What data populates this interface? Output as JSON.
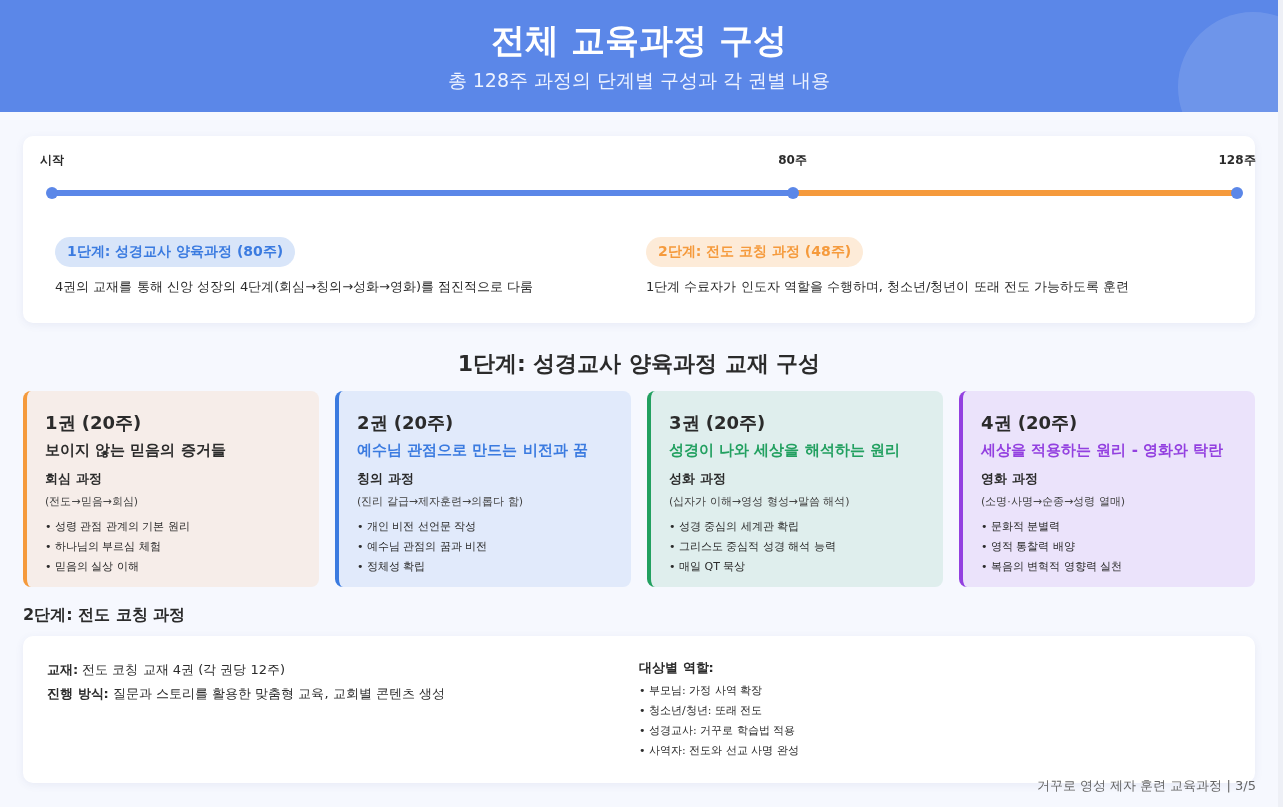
{
  "header": {
    "title": "전체 교육과정 구성",
    "subtitle": "총 128주 과정의 단계별 구성과 각 권별 내용"
  },
  "timeline": {
    "markers": [
      {
        "label": "시작",
        "level": 0
      },
      {
        "label": "80주",
        "level": 0.625
      },
      {
        "label": "128주",
        "level": 1
      }
    ],
    "progress": {
      "level": 0.625
    },
    "phases": [
      {
        "badge": "1단계: 성경교사 양육과정 (80주)",
        "color": "#3b7be0",
        "description": "4권의 교재를 통해 신앙 성장의 4단계(회심→칭의→성화→영화)를 점진적으로 다룸"
      },
      {
        "badge": "2단계: 전도 코칭 과정 (48주)",
        "color": "#f59a3c",
        "description": "1단계 수료자가 인도자 역할을 수행하며, 청소년/청년이 또래 전도 가능하도록 훈련"
      }
    ]
  },
  "books_section": {
    "title": "1단계: 성경교사 양육과정 교재 구성",
    "books": [
      {
        "volume": "1권 (20주)",
        "title": "보이지 않는 믿음의 증거들",
        "color": "#f59a3c",
        "stage": "회심 과정",
        "flow": "(전도→믿음→회심)",
        "points": [
          "• 성령 관점 관계의 기본 원리",
          "• 하나님의 부르심 체험",
          "• 믿음의 실상 이해"
        ]
      },
      {
        "volume": "2권 (20주)",
        "title": "예수님 관점으로 만드는 비전과 꿈",
        "color": "#3b7be0",
        "stage": "칭의 과정",
        "flow": "(진리 갈급→제자훈련→의롭다 함)",
        "points": [
          "• 개인 비전 선언문 작성",
          "• 예수님 관점의 꿈과 비전",
          "• 정체성 확립"
        ]
      },
      {
        "volume": "3권 (20주)",
        "title": "성경이 나와 세상을 해석하는 원리",
        "color": "#22a060",
        "stage": "성화 과정",
        "flow": "(십자가 이해→영성 형성→말씀 해석)",
        "points": [
          "• 성경 중심의 세계관 확립",
          "• 그리스도 중심적 성경 해석 능력",
          "• 매일 QT 묵상"
        ]
      },
      {
        "volume": "4권 (20주)",
        "title": "세상을 적용하는 원리 - 영화와 탁란",
        "color": "#9340e0",
        "stage": "영화 과정",
        "flow": "(소명·사명→순종→성령 열매)",
        "points": [
          "• 문화적 분별력",
          "• 영적 통찰력 배양",
          "• 복음의 변혁적 영향력 실천"
        ]
      }
    ]
  },
  "coaching_section": {
    "title": "2단계: 전도 코칭 과정",
    "details": [
      "**교재:** 전도 코칭 교재 4권 (각 권당 12주)",
      "**진행 방식:** 질문과 스토리를 활용한 맞춤형 교육, 교회별 콘텐츠 생성"
    ],
    "roles_title": "대상별 역할:",
    "roles": [
      "• 부모님: 가정 사역 확장",
      "• 청소년/청년: 또래 전도",
      "• 성경교사: 거꾸로 학습법 적용",
      "• 사역자: 전도와 선교 사명 완성"
    ]
  },
  "footer": "거꾸로 영성 제자 훈련 교육과정 | 3/5"
}
